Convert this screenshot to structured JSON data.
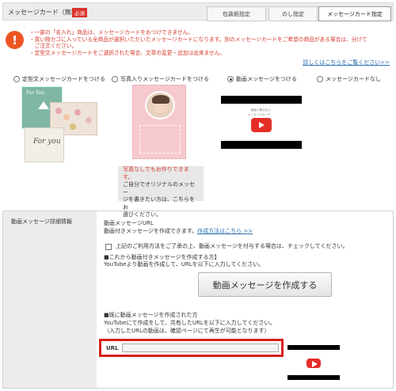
{
  "header": {
    "title": "メッセージカード（無料）",
    "required_badge": "必須",
    "steps": [
      "包装紙指定",
      "のし指定",
      "メッセージカード指定"
    ]
  },
  "notice": {
    "lines": [
      "・一部の「名入れ」商品は、メッセージカードをおつけできません。",
      "・買い物カゴに入っている全商品が選択いただいたメッセージカードになります。別のメッセージカードをご希望の商品がある場合は、分けて",
      "　ご注文ください。",
      "・定型文メッセージカードをご選択された場合、文章の変更・追加は出来ません。"
    ],
    "detail_link": "詳しくはこちらをご覧ください>>"
  },
  "card_options": [
    {
      "label": "定型文メッセージカードをつける",
      "checked": false
    },
    {
      "label": "写真入りメッセージカードをつける",
      "checked": false
    },
    {
      "label": "動画メッセージをつける",
      "checked": true
    },
    {
      "label": "メッセージカードなし",
      "checked": false
    }
  ],
  "card_samples": {
    "for_you_1": "For You",
    "for_you_2": "For you"
  },
  "photo_note": {
    "red_line": "写真なしでもお作りできます。",
    "lines": [
      "ご自分でオリジナルのメッセー",
      "ジを書きたい方は、こちらをお",
      "選びください。"
    ]
  },
  "video_thumb_text": {
    "line1": "動画で贈るなら",
    "line2": "メッセージカード"
  },
  "video_section": {
    "side_label": "動画メッセージ詳細情報",
    "heading": "動画メッセージURL",
    "intro": "動画付きメッセージを作成できます。",
    "howto_link": "作成方法はこちら >>",
    "consent_checkbox": "上記のご利用方法をご了承の上、動画メッセージを付与する場合は、チェックしてください。",
    "create_heading": "■これから動画付きメッセージを作成する方】",
    "create_desc": "YouTubeより動画を作成して、URLを以下に入力してください。",
    "create_button": "動画メッセージを作成する",
    "existing_heading": "■既に動画メッセージを作成された方",
    "existing_desc1": "YouTubeにて作成をして、共有したURLを以下に入力してください。",
    "existing_desc2": "（入力したURLの動画は、確認ページにて再生が可能となります）",
    "url_label": "URL",
    "url_value": ""
  },
  "colors": {
    "accent_red": "#d8201c",
    "link_blue": "#2b6fb3",
    "notice_red": "#d63a2e",
    "play_red": "#e52d27"
  },
  "icons": {
    "notice": "exclamation-icon",
    "play": "play-icon"
  }
}
